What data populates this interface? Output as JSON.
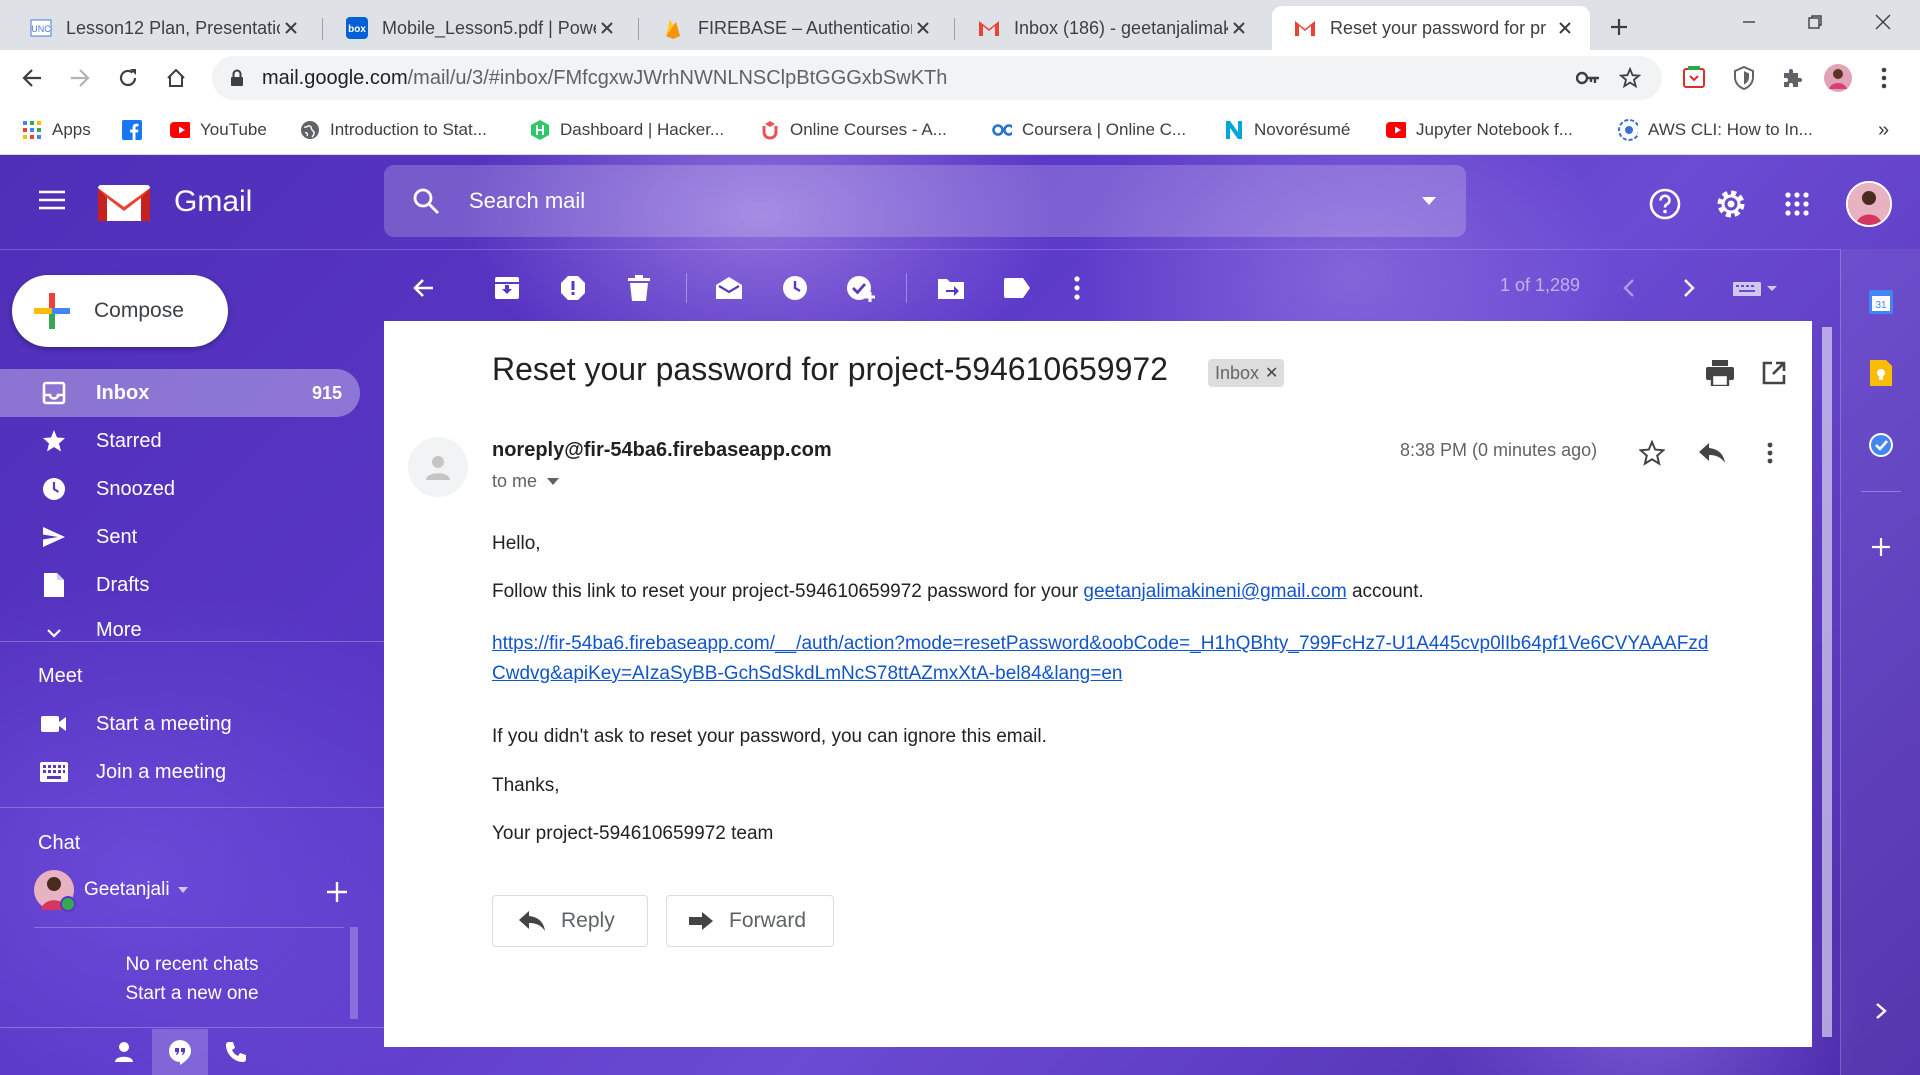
{
  "browser": {
    "tabs": [
      {
        "title": "Lesson12 Plan, Presentation",
        "icon": "unc-favicon"
      },
      {
        "title": "Mobile_Lesson5.pdf | Powe",
        "icon": "box-favicon"
      },
      {
        "title": "FIREBASE – Authentication",
        "icon": "firebase-favicon"
      },
      {
        "title": "Inbox (186) - geetanjalimak",
        "icon": "gmail-favicon"
      },
      {
        "title": "Reset your password for pr",
        "icon": "gmail-favicon",
        "active": true
      }
    ],
    "url_host": "mail.google.com",
    "url_path": "/mail/u/3/#inbox/FMfcgxwJWrhNWNLNSClpBtGGGxbSwKTh",
    "bookmarks": [
      {
        "label": "Apps",
        "icon": "apps-grid-icon"
      },
      {
        "label": "",
        "icon": "facebook-icon"
      },
      {
        "label": "YouTube",
        "icon": "youtube-icon"
      },
      {
        "label": "Introduction to Stat...",
        "icon": "globe-icon"
      },
      {
        "label": "Dashboard | Hacker...",
        "icon": "hackerrank-icon"
      },
      {
        "label": "Online Courses - A...",
        "icon": "udemy-icon"
      },
      {
        "label": "Coursera | Online C...",
        "icon": "coursera-icon"
      },
      {
        "label": "Novorésumé",
        "icon": "novoresume-icon"
      },
      {
        "label": "Jupyter Notebook f...",
        "icon": "youtube-icon"
      },
      {
        "label": "AWS CLI: How to In...",
        "icon": "aws-icon"
      }
    ],
    "more_bookmarks": "»"
  },
  "gmail": {
    "brand": "Gmail",
    "search_placeholder": "Search mail",
    "compose_label": "Compose",
    "nav": [
      {
        "label": "Inbox",
        "count": "915",
        "icon": "inbox-icon",
        "active": true
      },
      {
        "label": "Starred",
        "count": "",
        "icon": "star-icon"
      },
      {
        "label": "Snoozed",
        "count": "",
        "icon": "clock-icon"
      },
      {
        "label": "Sent",
        "count": "",
        "icon": "send-icon"
      },
      {
        "label": "Drafts",
        "count": "",
        "icon": "draft-icon"
      },
      {
        "label": "More",
        "count": "",
        "icon": "chevron-down-icon"
      }
    ],
    "meet": {
      "heading": "Meet",
      "start": "Start a meeting",
      "join": "Join a meeting"
    },
    "chat": {
      "heading": "Chat",
      "user": "Geetanjali",
      "empty_line1": "No recent chats",
      "empty_line2": "Start a new one"
    },
    "pager": "1 of 1,289",
    "message": {
      "subject": "Reset your password for project-594610659972",
      "label": "Inbox",
      "sender": "noreply@fir-54ba6.firebaseapp.com",
      "recipient": "to me",
      "time": "8:38 PM (0 minutes ago)",
      "greeting": "Hello,",
      "line1_before": "Follow this link to reset your project-594610659972 password for your ",
      "line1_email": "geetanjalimakineni@gmail.com",
      "line1_after": " account.",
      "link_line1": "https://fir-54ba6.firebaseapp.com/__/auth/action?mode=resetPassword&oobCode=_H1hQBhty_799FcHz7-U1A445cvp0lIb64pf1Ve6CVYAAAFzd",
      "link_line2": "Cwdvg&apiKey=AIzaSyBB-GchSdSkdLmNcS78ttAZmxXtA-bel84&lang=en",
      "ignore": "If you didn't ask to reset your password, you can ignore this email.",
      "thanks": "Thanks,",
      "signoff": "Your project-594610659972 team",
      "reply_label": "Reply",
      "forward_label": "Forward"
    }
  },
  "colors": {
    "gmail_red": "#ea4335",
    "link_blue": "#1155cc",
    "accent_purple": "#5a37c7"
  }
}
